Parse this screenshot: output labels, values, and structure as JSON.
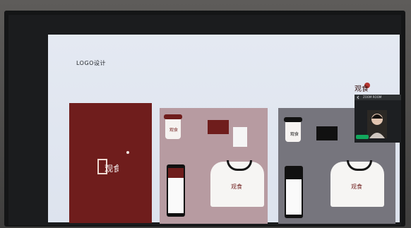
{
  "slide": {
    "title": "LOGO设计",
    "logo_text": "观食"
  },
  "meeting": {
    "tile_title": "ZOOM ROOM"
  },
  "colors": {
    "brand_red": "#6f1d1c",
    "slide_bg": "#e4e9f2",
    "pink_panel": "#b79ba1",
    "gray_panel": "#76757d",
    "mic_green": "#12a75d"
  },
  "icons": {
    "menu_arrow": "chevron-left-icon",
    "microphone": "microphone-icon"
  }
}
